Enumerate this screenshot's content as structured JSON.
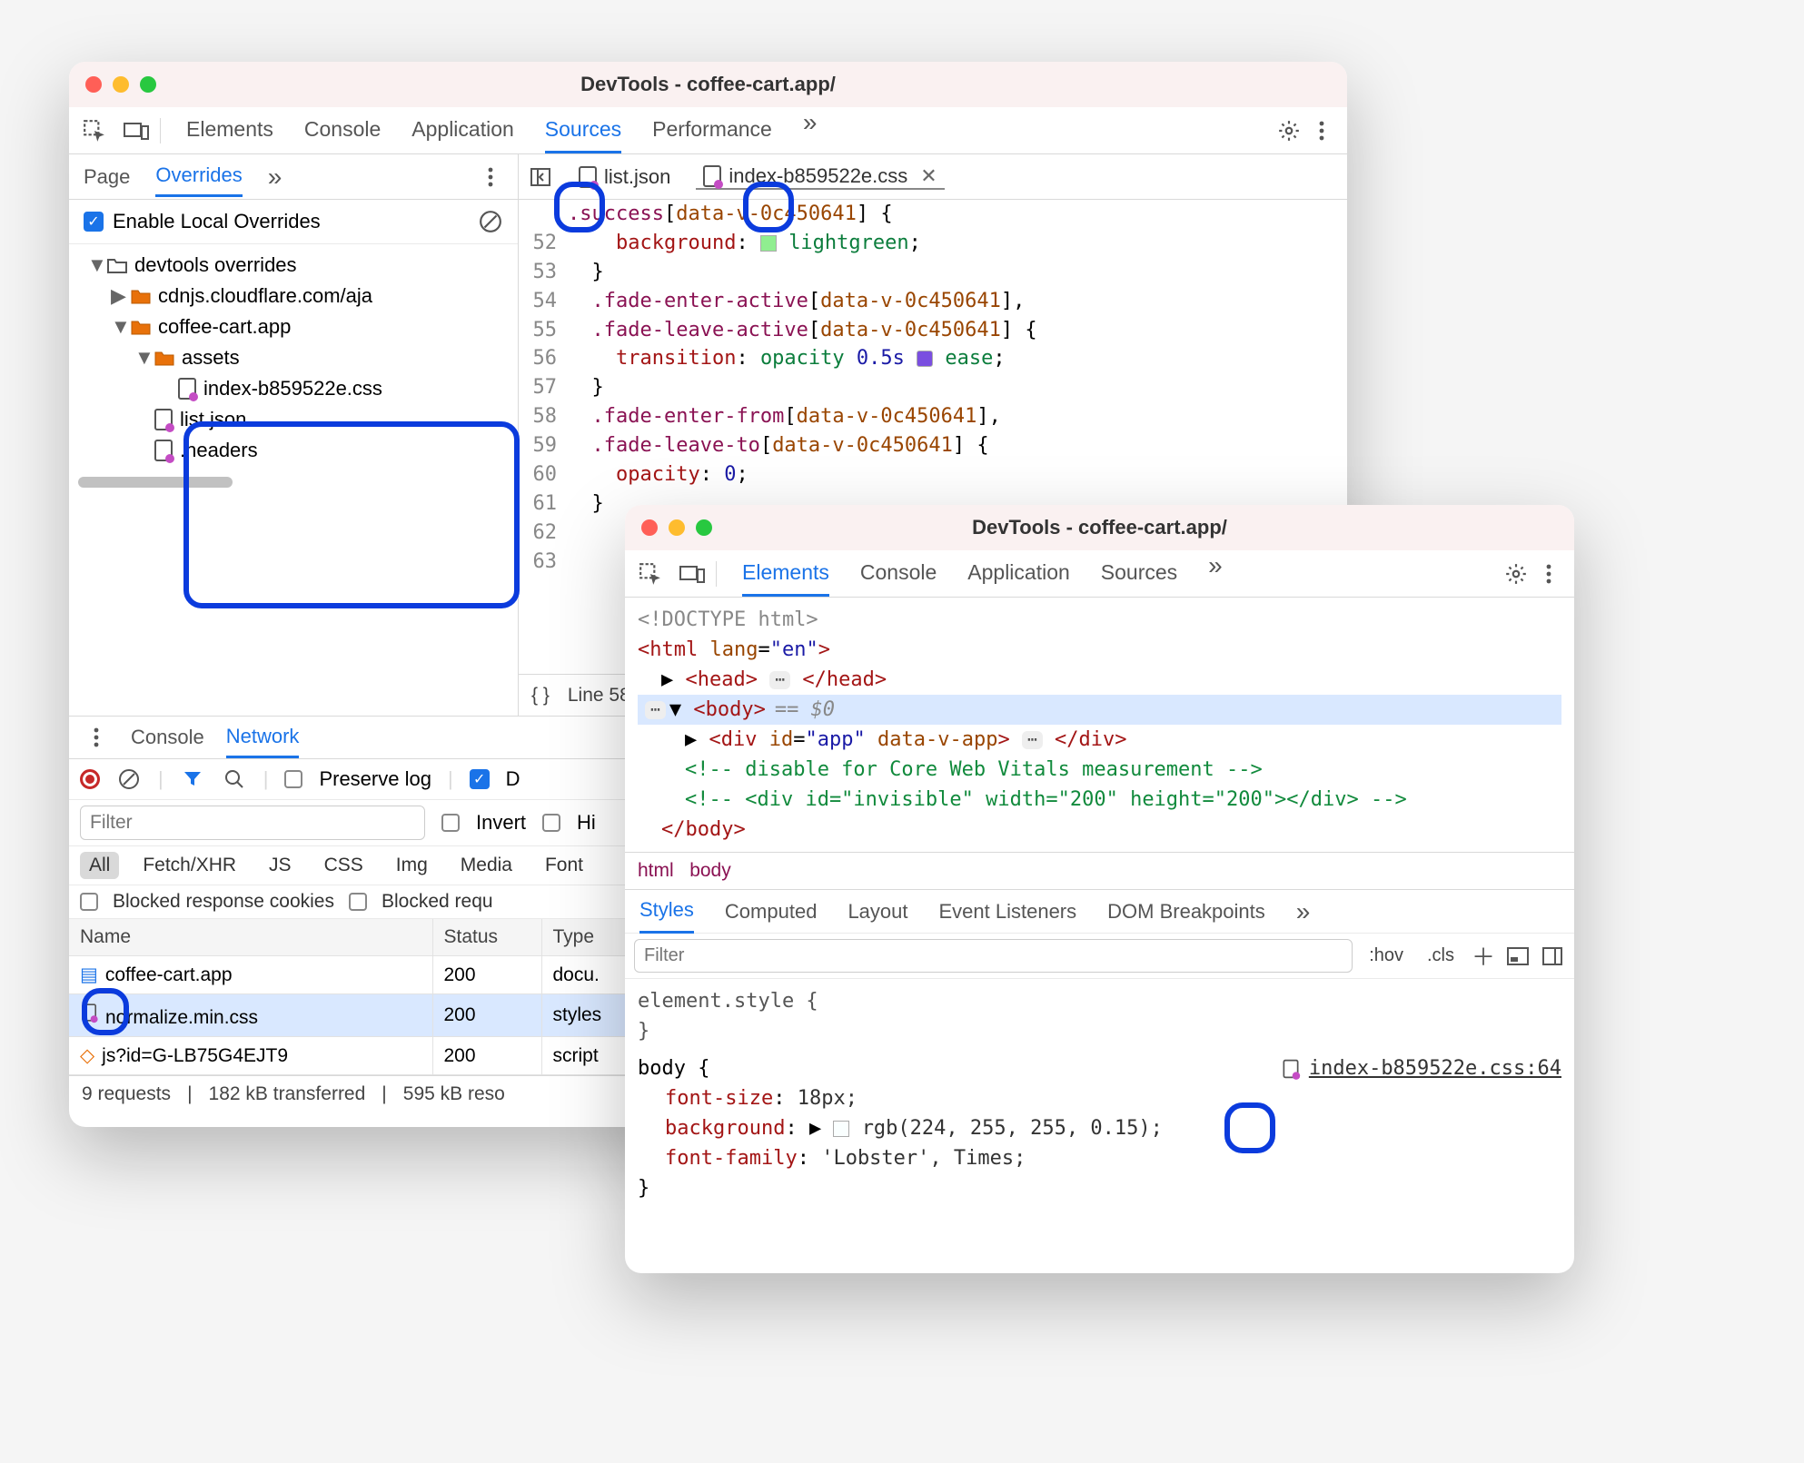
{
  "win1": {
    "title": "DevTools - coffee-cart.app/",
    "tabs": [
      "Elements",
      "Console",
      "Application",
      "Sources",
      "Performance"
    ],
    "tab_active": "Sources",
    "subtabs": {
      "page": "Page",
      "overrides": "Overrides"
    },
    "overrides_label": "Enable Local Overrides",
    "tree": {
      "root": "devtools overrides",
      "items": [
        {
          "label": "cdnjs.cloudflare.com/aja"
        },
        {
          "label": "coffee-cart.app"
        },
        {
          "label": "assets"
        },
        {
          "label": "index-b859522e.css"
        },
        {
          "label": "list.json"
        },
        {
          "label": ".headers"
        }
      ]
    },
    "editor_tabs": {
      "t1": "list.json",
      "t2": "index-b859522e.css"
    },
    "code_lines": [
      {
        "n": 52,
        "txt_prop": "background",
        "txt_val": "lightgreen"
      },
      {
        "n": 53
      },
      {
        "n": 54,
        "sel": ".fade-enter-active",
        "attr": "data-v-0c450641"
      },
      {
        "n": 55,
        "sel": ".fade-leave-active",
        "attr": "data-v-0c450641"
      },
      {
        "n": 56,
        "txt_prop": "transition",
        "opac": "opacity",
        "dur": "0.5s",
        "ease": "ease"
      },
      {
        "n": 57
      },
      {
        "n": 58,
        "sel": ".fade-enter-from",
        "attr": "data-v-0c450641"
      },
      {
        "n": 59,
        "sel": ".fade-leave-to",
        "attr": "data-v-0c450641"
      },
      {
        "n": 60,
        "txt_prop": "opacity",
        "num": "0"
      },
      {
        "n": 61
      },
      {
        "n": 62
      },
      {
        "n": 63
      }
    ],
    "statusbar": {
      "line": "Line 58"
    },
    "drawer_tabs": {
      "console": "Console",
      "network": "Network"
    },
    "net_toolbar": {
      "preserve": "Preserve log",
      "invert": "Invert",
      "hide": "Hi"
    },
    "chips": [
      "All",
      "Fetch/XHR",
      "JS",
      "CSS",
      "Img",
      "Media",
      "Font"
    ],
    "chips2": {
      "a": "Blocked response cookies",
      "b": "Blocked requ"
    },
    "filter_ph": "Filter",
    "net_cols": {
      "name": "Name",
      "status": "Status",
      "type": "Type"
    },
    "net_rows": [
      {
        "name": "coffee-cart.app",
        "status": "200",
        "type": "docu."
      },
      {
        "name": "normalize.min.css",
        "status": "200",
        "type": "styles"
      },
      {
        "name": "js?id=G-LB75G4EJT9",
        "status": "200",
        "type": "script"
      }
    ],
    "net_status": {
      "req": "9 requests",
      "tx": "182 kB transferred",
      "res": "595 kB reso"
    }
  },
  "win2": {
    "title": "DevTools - coffee-cart.app/",
    "tabs": [
      "Elements",
      "Console",
      "Application",
      "Sources"
    ],
    "tab_active": "Elements",
    "dom": {
      "doctype": "<!DOCTYPE html>",
      "html_open": {
        "tag": "html",
        "attrn": "lang",
        "attrv": "en"
      },
      "head": "head",
      "body": "body",
      "eq0": "== $0",
      "div": {
        "tag": "div",
        "idn": "id",
        "idv": "app",
        "dv": "data-v-app"
      },
      "cmt1": "<!-- disable for Core Web Vitals measurement -->",
      "cmt2": "<!-- <div id=\"invisible\" width=\"200\" height=\"200\"></div> -->",
      "body_close": "body"
    },
    "breadcrumb": {
      "html": "html",
      "body": "body"
    },
    "styles_tabs": [
      "Styles",
      "Computed",
      "Layout",
      "Event Listeners",
      "DOM Breakpoints"
    ],
    "styles_filter_ph": "Filter",
    "hov": ":hov",
    "cls": ".cls",
    "element_style": "element.style {",
    "body_sel": "body {",
    "link": "index-b859522e.css:64",
    "props": [
      {
        "p": "font-size",
        "v": "18px;"
      },
      {
        "p": "background",
        "v": "rgb(224, 255, 255, 0.15);"
      },
      {
        "p": "font-family",
        "v": "'Lobster', Times;"
      }
    ]
  }
}
